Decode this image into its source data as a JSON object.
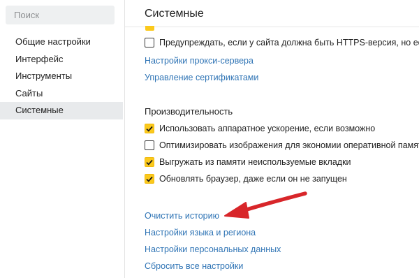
{
  "sidebar": {
    "search": {
      "placeholder": "Поиск"
    },
    "items": [
      {
        "label": "Общие настройки"
      },
      {
        "label": "Интерфейс"
      },
      {
        "label": "Инструменты"
      },
      {
        "label": "Сайты"
      },
      {
        "label": "Системные",
        "active": true
      }
    ]
  },
  "main": {
    "title": "Системные",
    "network": {
      "checkbox_https": {
        "label": "Предупреждать, если у сайта должна быть HTTPS-версия, но её нет",
        "checked": false
      },
      "links": [
        {
          "label": "Настройки прокси-сервера"
        },
        {
          "label": "Управление сертификатами"
        }
      ]
    },
    "performance": {
      "title": "Производительность",
      "options": [
        {
          "label": "Использовать аппаратное ускорение, если возможно",
          "checked": true
        },
        {
          "label": "Оптимизировать изображения для экономии оперативной памяти",
          "checked": false
        },
        {
          "label": "Выгружать из памяти неиспользуемые вкладки",
          "checked": true
        },
        {
          "label": "Обновлять браузер, даже если он не запущен",
          "checked": true
        }
      ]
    },
    "actions": [
      {
        "label": "Очистить историю"
      },
      {
        "label": "Настройки языка и региона"
      },
      {
        "label": "Настройки персональных данных"
      },
      {
        "label": "Сбросить все настройки"
      }
    ]
  },
  "colors": {
    "accent_checkbox": "#fbc91c",
    "link": "#2f74b5",
    "arrow": "#d8262a",
    "active_nav_bg": "#e8eaec"
  },
  "icons": {
    "checkmark": "check-icon",
    "annotation": "red-arrow-annotation"
  }
}
